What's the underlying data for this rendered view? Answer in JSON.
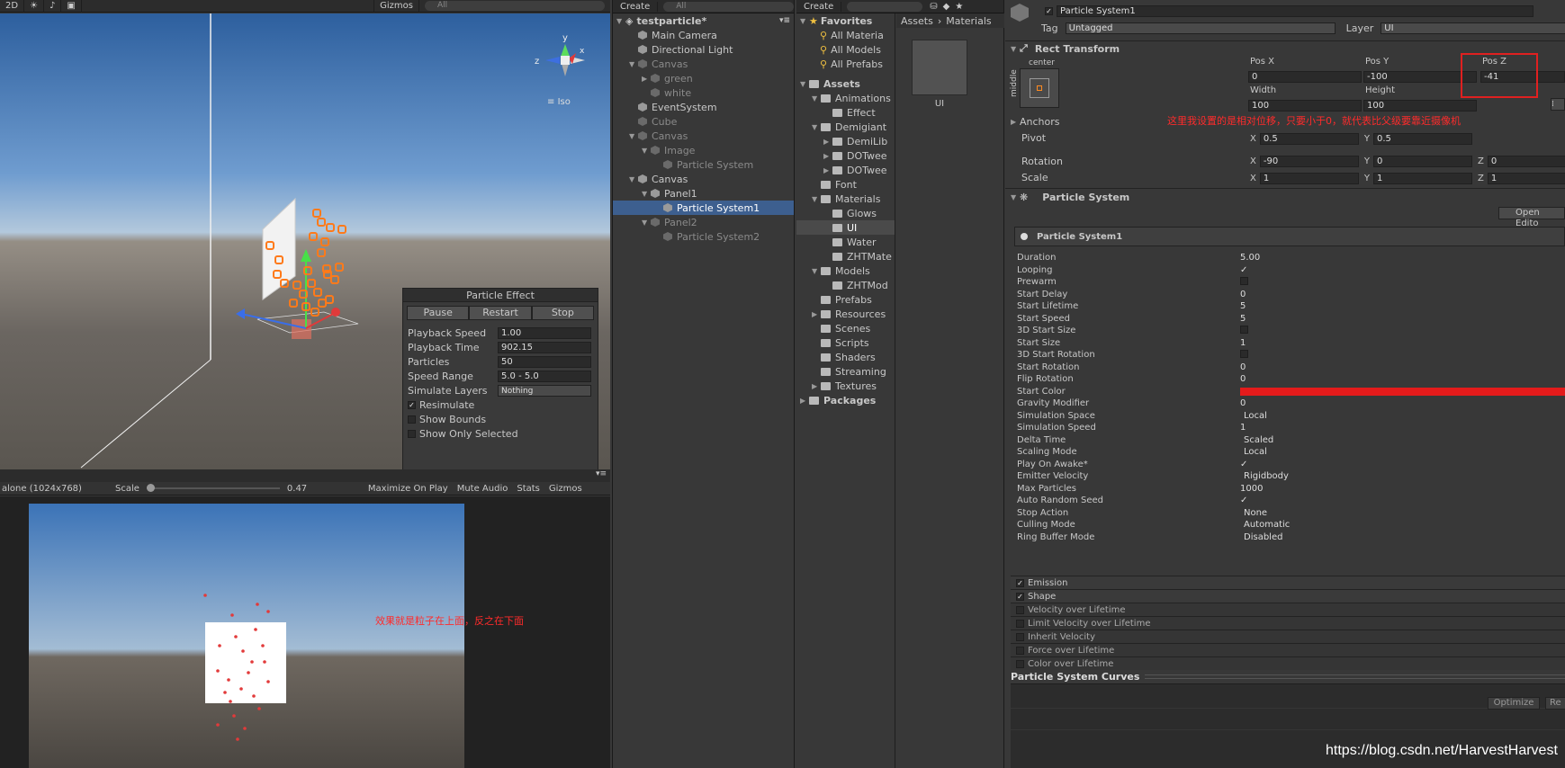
{
  "scene": {
    "toolbar": {
      "mode": "2D",
      "gizmos": "Gizmos",
      "search": "All"
    },
    "iso_label": "Iso",
    "particle_effect": {
      "title": "Particle Effect",
      "buttons": [
        "Pause",
        "Restart",
        "Stop"
      ],
      "rows": [
        {
          "label": "Playback Speed",
          "value": "1.00"
        },
        {
          "label": "Playback Time",
          "value": "902.15"
        },
        {
          "label": "Particles",
          "value": "50"
        },
        {
          "label": "Speed Range",
          "value": "5.0 - 5.0"
        },
        {
          "label": "Simulate Layers",
          "value": "Nothing"
        }
      ],
      "checks": [
        {
          "label": "Resimulate",
          "checked": true
        },
        {
          "label": "Show Bounds",
          "checked": false
        },
        {
          "label": "Show Only Selected",
          "checked": false
        }
      ]
    }
  },
  "game": {
    "toolbar": {
      "resolution": "alone (1024x768)",
      "scale_label": "Scale",
      "scale_value": "0.47",
      "maximize": "Maximize On Play",
      "mute": "Mute Audio",
      "stats": "Stats",
      "gizmos": "Gizmos"
    },
    "note": "效果就是粒子在上面，反之在下面"
  },
  "hierarchy": {
    "create": "Create",
    "search": "All",
    "scene_name": "testparticle*",
    "items": [
      {
        "label": "Main Camera",
        "indent": 1,
        "dim": false,
        "arrow": ""
      },
      {
        "label": "Directional Light",
        "indent": 1,
        "dim": false,
        "arrow": ""
      },
      {
        "label": "Canvas",
        "indent": 1,
        "dim": true,
        "arrow": "▼"
      },
      {
        "label": "green",
        "indent": 2,
        "dim": true,
        "arrow": "▶"
      },
      {
        "label": "white",
        "indent": 2,
        "dim": true,
        "arrow": ""
      },
      {
        "label": "EventSystem",
        "indent": 1,
        "dim": false,
        "arrow": ""
      },
      {
        "label": "Cube",
        "indent": 1,
        "dim": true,
        "arrow": ""
      },
      {
        "label": "Canvas",
        "indent": 1,
        "dim": true,
        "arrow": "▼"
      },
      {
        "label": "Image",
        "indent": 2,
        "dim": true,
        "arrow": "▼"
      },
      {
        "label": "Particle System",
        "indent": 3,
        "dim": true,
        "arrow": ""
      },
      {
        "label": "Canvas",
        "indent": 1,
        "dim": false,
        "arrow": "▼"
      },
      {
        "label": "Panel1",
        "indent": 2,
        "dim": false,
        "arrow": "▼"
      },
      {
        "label": "Particle System1",
        "indent": 3,
        "dim": false,
        "arrow": "",
        "selected": true
      },
      {
        "label": "Panel2",
        "indent": 2,
        "dim": true,
        "arrow": "▼"
      },
      {
        "label": "Particle System2",
        "indent": 3,
        "dim": true,
        "arrow": ""
      }
    ]
  },
  "project": {
    "create": "Create",
    "breadcrumb": [
      "Assets",
      "Materials"
    ],
    "favorites_label": "Favorites",
    "favorites": [
      "All Materia",
      "All Models",
      "All Prefabs"
    ],
    "assets_label": "Assets",
    "tree": [
      {
        "label": "Animations",
        "indent": 1,
        "arrow": "▼"
      },
      {
        "label": "Effect",
        "indent": 2,
        "arrow": ""
      },
      {
        "label": "Demigiant",
        "indent": 1,
        "arrow": "▼"
      },
      {
        "label": "DemiLib",
        "indent": 2,
        "arrow": "▶"
      },
      {
        "label": "DOTwee",
        "indent": 2,
        "arrow": "▶"
      },
      {
        "label": "DOTwee",
        "indent": 2,
        "arrow": "▶"
      },
      {
        "label": "Font",
        "indent": 1,
        "arrow": ""
      },
      {
        "label": "Materials",
        "indent": 1,
        "arrow": "▼"
      },
      {
        "label": "Glows",
        "indent": 2,
        "arrow": ""
      },
      {
        "label": "UI",
        "indent": 2,
        "arrow": "",
        "selected": true
      },
      {
        "label": "Water",
        "indent": 2,
        "arrow": ""
      },
      {
        "label": "ZHTMate",
        "indent": 2,
        "arrow": ""
      },
      {
        "label": "Models",
        "indent": 1,
        "arrow": "▼"
      },
      {
        "label": "ZHTMod",
        "indent": 2,
        "arrow": ""
      },
      {
        "label": "Prefabs",
        "indent": 1,
        "arrow": ""
      },
      {
        "label": "Resources",
        "indent": 1,
        "arrow": "▶"
      },
      {
        "label": "Scenes",
        "indent": 1,
        "arrow": ""
      },
      {
        "label": "Scripts",
        "indent": 1,
        "arrow": ""
      },
      {
        "label": "Shaders",
        "indent": 1,
        "arrow": ""
      },
      {
        "label": "Streaming",
        "indent": 1,
        "arrow": ""
      },
      {
        "label": "Textures",
        "indent": 1,
        "arrow": "▶"
      }
    ],
    "packages_label": "Packages",
    "asset_thumb_label": "UI"
  },
  "inspector": {
    "object_name": "Particle System1",
    "tag_label": "Tag",
    "tag_value": "Untagged",
    "layer_label": "Layer",
    "layer_value": "UI",
    "rect_transform": {
      "title": "Rect Transform",
      "anchor_h": "center",
      "anchor_v": "middle",
      "pos_x_label": "Pos X",
      "pos_y_label": "Pos Y",
      "pos_z_label": "Pos Z",
      "pos_x": "0",
      "pos_y": "-100",
      "pos_z": "-41",
      "width_label": "Width",
      "height_label": "Height",
      "width": "100",
      "height": "100",
      "anchors_label": "Anchors",
      "note": "这里我设置的是相对位移，只要小于0，就代表比父级要靠近摄像机",
      "pivot_label": "Pivot",
      "pivot_x": "0.5",
      "pivot_y": "0.5",
      "rotation_label": "Rotation",
      "rot_x": "-90",
      "rot_y": "0",
      "rot_z": "0",
      "scale_label": "Scale",
      "scale_x": "1",
      "scale_y": "1",
      "scale_z": "1"
    },
    "particle_system": {
      "title": "Particle System",
      "open_editor": "Open Edito",
      "sub_title": "Particle System1",
      "props": [
        {
          "label": "Duration",
          "value": "5.00"
        },
        {
          "label": "Looping",
          "value": "✓"
        },
        {
          "label": "Prewarm",
          "value": "☐"
        },
        {
          "label": "Start Delay",
          "value": "0"
        },
        {
          "label": "Start Lifetime",
          "value": "5"
        },
        {
          "label": "Start Speed",
          "value": "5"
        },
        {
          "label": "3D Start Size",
          "value": "☐"
        },
        {
          "label": "Start Size",
          "value": "1"
        },
        {
          "label": "3D Start Rotation",
          "value": "☐"
        },
        {
          "label": "Start Rotation",
          "value": "0"
        },
        {
          "label": "Flip Rotation",
          "value": "0"
        },
        {
          "label": "Start Color",
          "value": "",
          "color": "#e41b1b"
        },
        {
          "label": "Gravity Modifier",
          "value": "0"
        },
        {
          "label": "Simulation Space",
          "value": "Local"
        },
        {
          "label": "Simulation Speed",
          "value": "1"
        },
        {
          "label": "Delta Time",
          "value": "Scaled"
        },
        {
          "label": "Scaling Mode",
          "value": "Local"
        },
        {
          "label": "Play On Awake*",
          "value": "✓"
        },
        {
          "label": "Emitter Velocity",
          "value": "Rigidbody"
        },
        {
          "label": "Max Particles",
          "value": "1000"
        },
        {
          "label": "Auto Random Seed",
          "value": "✓"
        },
        {
          "label": "Stop Action",
          "value": "None"
        },
        {
          "label": "Culling Mode",
          "value": "Automatic"
        },
        {
          "label": "Ring Buffer Mode",
          "value": "Disabled"
        }
      ],
      "modules": [
        {
          "label": "Emission",
          "checked": true
        },
        {
          "label": "Shape",
          "checked": true
        },
        {
          "label": "Velocity over Lifetime",
          "checked": false
        },
        {
          "label": "Limit Velocity over Lifetime",
          "checked": false
        },
        {
          "label": "Inherit Velocity",
          "checked": false
        },
        {
          "label": "Force over Lifetime",
          "checked": false
        },
        {
          "label": "Color over Lifetime",
          "checked": false
        }
      ]
    },
    "curves": {
      "title": "Particle System Curves",
      "optimize": "Optimize",
      "remove": "Re"
    }
  },
  "watermark": "https://blog.csdn.net/HarvestHarvest",
  "colors": {
    "selection": "#3d5f8f",
    "note_red": "#ff2b2b",
    "start_color": "#e41b1b"
  }
}
